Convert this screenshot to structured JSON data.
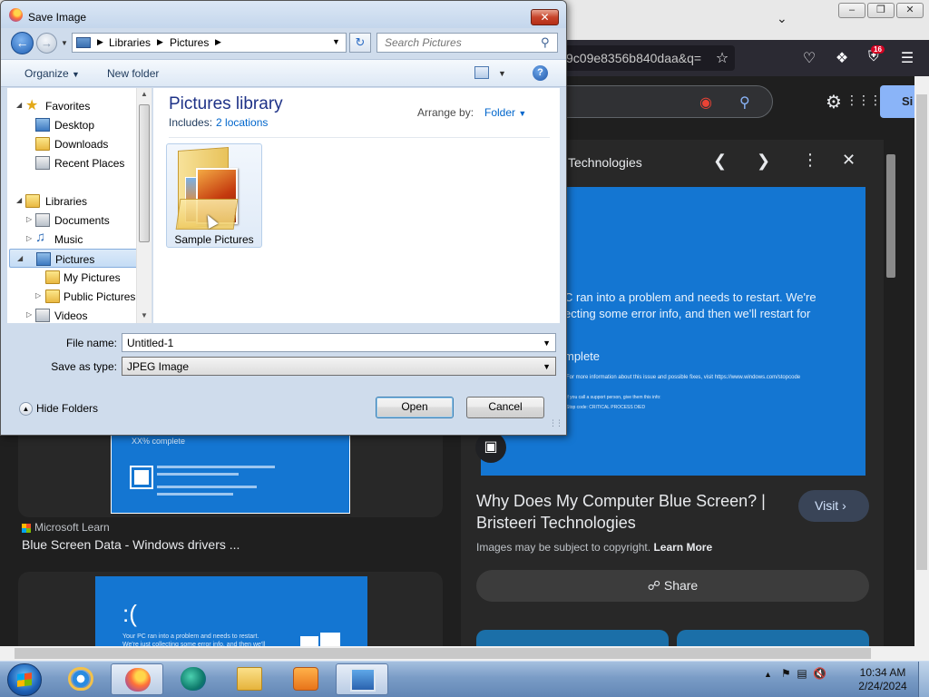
{
  "browser": {
    "url_fragment": "9c09e8356b840daa&q=",
    "extension_badge": "16",
    "window_buttons": [
      "–",
      "❐",
      "✕"
    ],
    "signin_partial": "Si"
  },
  "results": {
    "card1": {
      "thumb_text": "XX% complete",
      "source": "Microsoft Learn",
      "title": "Blue Screen Data - Windows drivers ..."
    },
    "card2": {
      "thumb_face": ":(",
      "thumb_text": "Your PC ran into a problem and needs to restart. We're just collecting some error info, and then we'll restart for you."
    }
  },
  "panel": {
    "source": "Technologies",
    "bsod_line1": "C ran into a problem and needs to restart. We're",
    "bsod_line2": "ecting some error info, and then we'll restart for",
    "bsod_complete": "mplete",
    "bsod_small1": "For more information about this issue and possible fixes, visit https://www.windows.com/stopcode",
    "bsod_small2": "If you call a support person, give them this info:",
    "bsod_small3": "Stop code: CRITICAL PROCESS DIED",
    "title": "Why Does My Computer Blue Screen? | Bristeeri Technologies",
    "visit_label": "Visit",
    "copyright": "Images may be subject to copyright.",
    "learn_more": "Learn More",
    "share_label": "Share"
  },
  "dialog": {
    "title": "Save Image",
    "close_label": "✕",
    "breadcrumb": [
      "Libraries",
      "Pictures"
    ],
    "search_placeholder": "Search Pictures",
    "organize_label": "Organize",
    "new_folder_label": "New folder",
    "nav": {
      "favorites": "Favorites",
      "desktop": "Desktop",
      "downloads": "Downloads",
      "recent_places": "Recent Places",
      "libraries": "Libraries",
      "documents": "Documents",
      "music": "Music",
      "pictures": "Pictures",
      "my_pictures": "My Pictures",
      "public_pictures": "Public Pictures",
      "videos": "Videos"
    },
    "content": {
      "library_title": "Pictures library",
      "includes_label": "Includes:",
      "includes_link": "2 locations",
      "arrange_label": "Arrange by:",
      "arrange_value": "Folder",
      "folder_name": "Sample Pictures"
    },
    "file_name_label": "File name:",
    "file_name_value": "Untitled-1",
    "save_type_label": "Save as type:",
    "save_type_value": "JPEG Image",
    "hide_folders_label": "Hide Folders",
    "open_label": "Open",
    "cancel_label": "Cancel"
  },
  "taskbar": {
    "clock_time": "10:34 AM",
    "clock_date": "2/24/2024"
  }
}
